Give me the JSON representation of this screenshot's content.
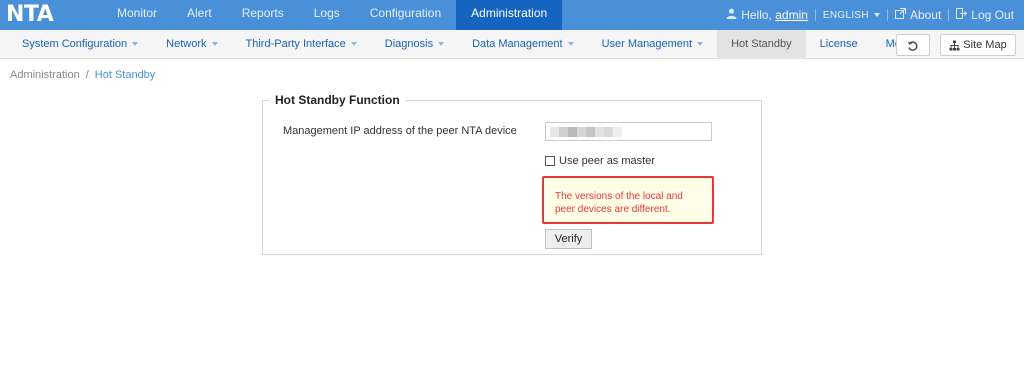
{
  "app": {
    "logo": "NTA"
  },
  "top_nav": [
    {
      "label": "Monitor"
    },
    {
      "label": "Alert"
    },
    {
      "label": "Reports"
    },
    {
      "label": "Logs"
    },
    {
      "label": "Configuration"
    },
    {
      "label": "Administration"
    }
  ],
  "user_bar": {
    "hello": "Hello,",
    "username": "admin",
    "language": "ENGLISH",
    "about": "About",
    "logout": "Log Out"
  },
  "sub_nav": [
    {
      "label": "System Configuration"
    },
    {
      "label": "Network"
    },
    {
      "label": "Third-Party Interface"
    },
    {
      "label": "Diagnosis"
    },
    {
      "label": "Data Management"
    },
    {
      "label": "User Management"
    },
    {
      "label": "Hot Standby"
    },
    {
      "label": "License"
    },
    {
      "label": "More"
    }
  ],
  "toolbar": {
    "site_map": "Site Map"
  },
  "breadcrumb": {
    "parent": "Administration",
    "sep": "/",
    "current": "Hot Standby"
  },
  "form": {
    "legend": "Hot Standby Function",
    "peer_ip_label": "Management IP address of the peer NTA device",
    "peer_ip_value": "",
    "use_peer_master_label": "Use peer as master",
    "use_peer_master_checked": false,
    "warning_line1": "The versions of the local and",
    "warning_line2": "peer devices are different.",
    "verify_label": "Verify"
  },
  "colors": {
    "topbar": "#4a90d9",
    "active_tab": "#1565c0",
    "link": "#1a63b5",
    "warning": "#e53935"
  },
  "icons": {
    "user": "user-icon",
    "external": "external-link-icon",
    "logout": "logout-icon",
    "refresh": "refresh-icon",
    "sitemap": "sitemap-icon"
  }
}
